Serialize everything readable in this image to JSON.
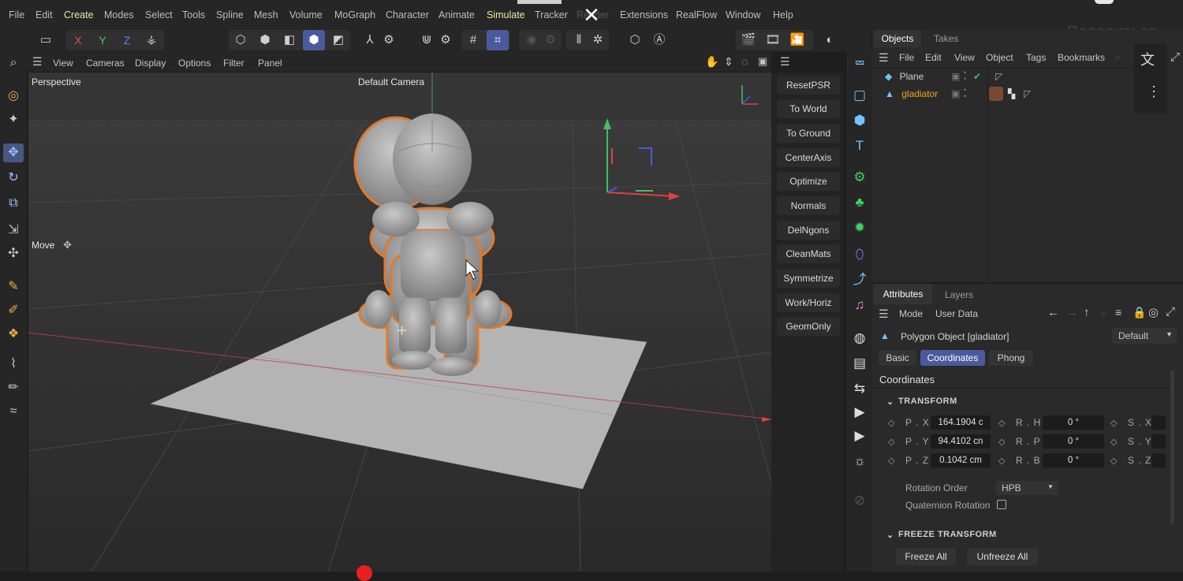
{
  "menu": [
    "File",
    "Edit",
    "Create",
    "Modes",
    "Select",
    "Tools",
    "Spline",
    "Mesh",
    "Volume",
    "MoGraph",
    "Character",
    "Animate",
    "Simulate",
    "Tracker",
    "Render",
    "Extensions",
    "RealFlow",
    "Window",
    "Help"
  ],
  "overlay": {
    "close_glyph": "✕",
    "share_label": "Поделиться"
  },
  "toolbar": {
    "x_label": "X",
    "y_label": "Y",
    "z_label": "Z"
  },
  "viewport_menu": [
    "View",
    "Cameras",
    "Display",
    "Options",
    "Filter",
    "Panel"
  ],
  "viewport": {
    "view_name": "Perspective",
    "camera_name": "Default Camera",
    "mode_label": "Move"
  },
  "plugin_buttons": [
    "ResetPSR",
    "To World",
    "To Ground",
    "CenterAxis",
    "Optimize",
    "Normals",
    "DelNgons",
    "CleanMats",
    "Symmetrize",
    "Work/Horiz",
    "GeomOnly"
  ],
  "objects_panel": {
    "tabs": [
      "Objects",
      "Takes"
    ],
    "menu": [
      "File",
      "Edit",
      "View",
      "Object",
      "Tags",
      "Bookmarks"
    ],
    "rows": [
      {
        "name": "Plane",
        "color": "#c8c8c8"
      },
      {
        "name": "gladiator",
        "color": "#f0a020"
      }
    ]
  },
  "attributes": {
    "tabs": [
      "Attributes",
      "Layers"
    ],
    "menu": [
      "Mode",
      "User Data"
    ],
    "object_title": "Polygon Object [gladiator]",
    "preset": "Default",
    "subtabs": [
      "Basic",
      "Coordinates",
      "Phong"
    ],
    "section_title": "Coordinates",
    "transform_header": "TRANSFORM",
    "fields": {
      "px_label": "P . X",
      "px": "164.1904 c",
      "py_label": "P . Y",
      "py": "94.4102 cn",
      "pz_label": "P . Z",
      "pz": "0.1042 cm",
      "rh_label": "R . H",
      "rh": "0 °",
      "rp_label": "R . P",
      "rp": "0 °",
      "rb_label": "R . B",
      "rb": "0 °",
      "sx_label": "S . X",
      "sy_label": "S . Y",
      "sz_label": "S . Z"
    },
    "rotation_order_label": "Rotation Order",
    "rotation_order": "HPB",
    "quaternion_label": "Quaternion Rotation",
    "freeze_header": "FREEZE TRANSFORM",
    "freeze_all": "Freeze All",
    "unfreeze_all": "Unfreeze All"
  },
  "colors": {
    "accent": "#4b5a9c",
    "selection_outline": "#e07a2a",
    "x_axis": "#e04040",
    "y_axis": "#40c060",
    "z_axis": "#4060e0"
  }
}
